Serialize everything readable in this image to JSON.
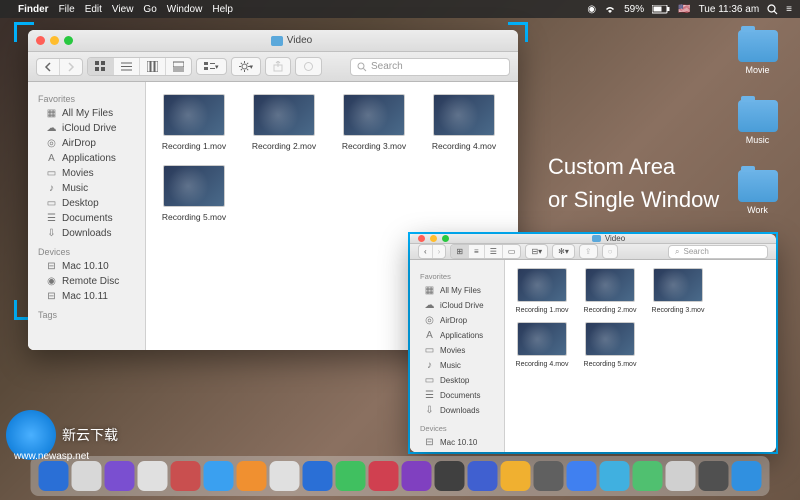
{
  "menubar": {
    "app": "Finder",
    "items": [
      "File",
      "Edit",
      "View",
      "Go",
      "Window",
      "Help"
    ],
    "battery": "59%",
    "time": "Tue 11:36 am"
  },
  "desktop_folders": [
    {
      "label": "Movie"
    },
    {
      "label": "Music"
    },
    {
      "label": "Work"
    }
  ],
  "promo": {
    "line1": "Custom Area",
    "line2": "or  Single Window"
  },
  "finder": {
    "title": "Video",
    "search_placeholder": "Search",
    "sidebar": {
      "sections": [
        {
          "header": "Favorites",
          "items": [
            {
              "icon": "all-files-icon",
              "label": "All My Files"
            },
            {
              "icon": "cloud-icon",
              "label": "iCloud Drive"
            },
            {
              "icon": "airdrop-icon",
              "label": "AirDrop"
            },
            {
              "icon": "applications-icon",
              "label": "Applications"
            },
            {
              "icon": "movies-icon",
              "label": "Movies"
            },
            {
              "icon": "music-icon",
              "label": "Music"
            },
            {
              "icon": "desktop-icon",
              "label": "Desktop"
            },
            {
              "icon": "documents-icon",
              "label": "Documents"
            },
            {
              "icon": "downloads-icon",
              "label": "Downloads"
            }
          ]
        },
        {
          "header": "Devices",
          "items": [
            {
              "icon": "disk-icon",
              "label": "Mac 10.10"
            },
            {
              "icon": "disc-icon",
              "label": "Remote Disc"
            },
            {
              "icon": "disk-icon",
              "label": "Mac 10.11"
            }
          ]
        },
        {
          "header": "Tags",
          "items": []
        }
      ]
    },
    "files": [
      {
        "name": "Recording 1.mov"
      },
      {
        "name": "Recording 2.mov"
      },
      {
        "name": "Recording 3.mov"
      },
      {
        "name": "Recording 4.mov"
      },
      {
        "name": "Recording 5.mov"
      }
    ]
  },
  "dock_colors": [
    "#2a6fd6",
    "#d8d8d8",
    "#7a4fd0",
    "#e0e0e0",
    "#c94f4f",
    "#3aa0f0",
    "#f09030",
    "#e0e0e0",
    "#2a6fd6",
    "#40c060",
    "#d04050",
    "#8040c0",
    "#404040",
    "#4060d0",
    "#f0b030",
    "#606060",
    "#4080f0",
    "#40b0e0",
    "#50c070",
    "#d0d0d0",
    "#505050",
    "#3090e0"
  ],
  "watermark": {
    "text": "新云下载",
    "url": "www.newasp.net"
  }
}
